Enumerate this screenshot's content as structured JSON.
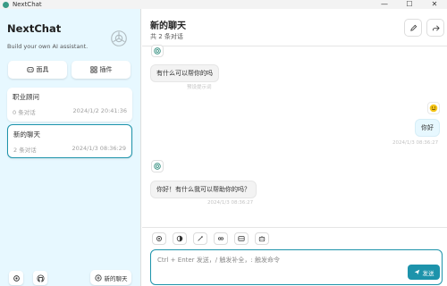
{
  "window": {
    "title": "NextChat",
    "controls": [
      "—",
      "☐",
      "✕"
    ]
  },
  "sidebar": {
    "brand_title": "NextChat",
    "brand_subtitle": "Build your own AI assistant.",
    "mask_button": "面具",
    "plugin_button": "插件",
    "chats": [
      {
        "title": "职业顾问",
        "count": "0 条对话",
        "time": "2024/1/2 20:41:36"
      },
      {
        "title": "新的聊天",
        "count": "2 条对话",
        "time": "2024/1/3 08:36:29"
      }
    ],
    "new_chat_label": "新的聊天"
  },
  "header": {
    "title": "新的聊天",
    "subtitle": "共 2 条对话"
  },
  "messages": [
    {
      "role": "bot",
      "text": "有什么可以帮你的吗",
      "time": "预设提示词"
    },
    {
      "role": "user",
      "text": "你好",
      "time": "2024/1/3 08:36:27"
    },
    {
      "role": "bot",
      "text": "你好！有什么我可以帮助你的吗？",
      "time": "2024/1/3 08:36:27"
    }
  ],
  "input": {
    "placeholder": "Ctrl + Enter 发送，/ 触发补全，: 触发命令",
    "send_label": "发送"
  },
  "colors": {
    "accent": "#1d93ab",
    "sidebar_bg": "#e7f8ff"
  }
}
